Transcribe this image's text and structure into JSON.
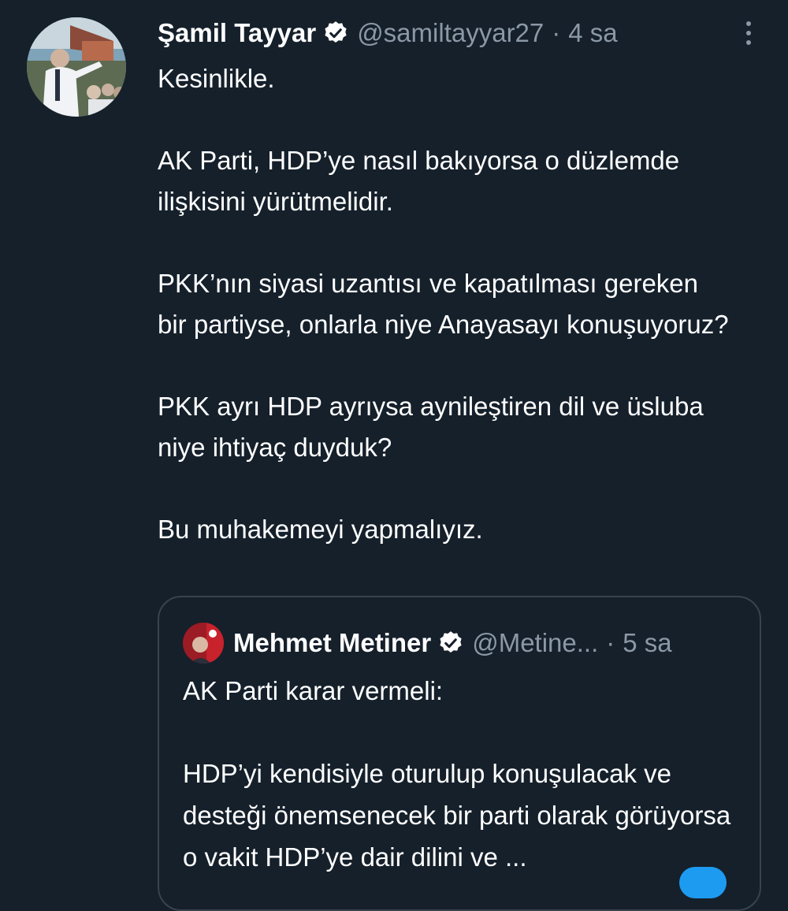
{
  "tweet": {
    "author": {
      "display_name": "Şamil Tayyar",
      "handle": "@samiltayyar27",
      "verified": true
    },
    "separator": "·",
    "time": "4 sa",
    "paragraphs": [
      "Kesinlikle.",
      "AK Parti, HDP’ye nasıl bakıyorsa o düzlemde ilişkisini yürütmelidir.",
      "PKK’nın siyasi uzantısı ve kapatılması gereken bir partiyse, onlarla niye Anayasayı konuşuyoruz?",
      "PKK ayrı HDP ayrıysa aynileştiren dil ve üsluba niye ihtiyaç duyduk?",
      "Bu muhakemeyi yapmalıyız."
    ],
    "more_icon": "more-vertical-icon"
  },
  "quoted_tweet": {
    "author": {
      "display_name": "Mehmet Metiner",
      "handle": "@Metine...",
      "verified": true
    },
    "separator": "·",
    "time": "5 sa",
    "paragraphs": [
      "AK Parti karar vermeli:",
      "HDP’yi kendisiyle oturulup konuşulacak ve desteği önemsenecek bir parti olarak görüyorsa o vakit HDP’ye dair dilini ve ..."
    ]
  },
  "colors": {
    "background": "#15202b",
    "text_primary": "#ffffff",
    "text_secondary": "#8b98a5",
    "border": "#38444d",
    "accent": "#1d9bf0"
  }
}
